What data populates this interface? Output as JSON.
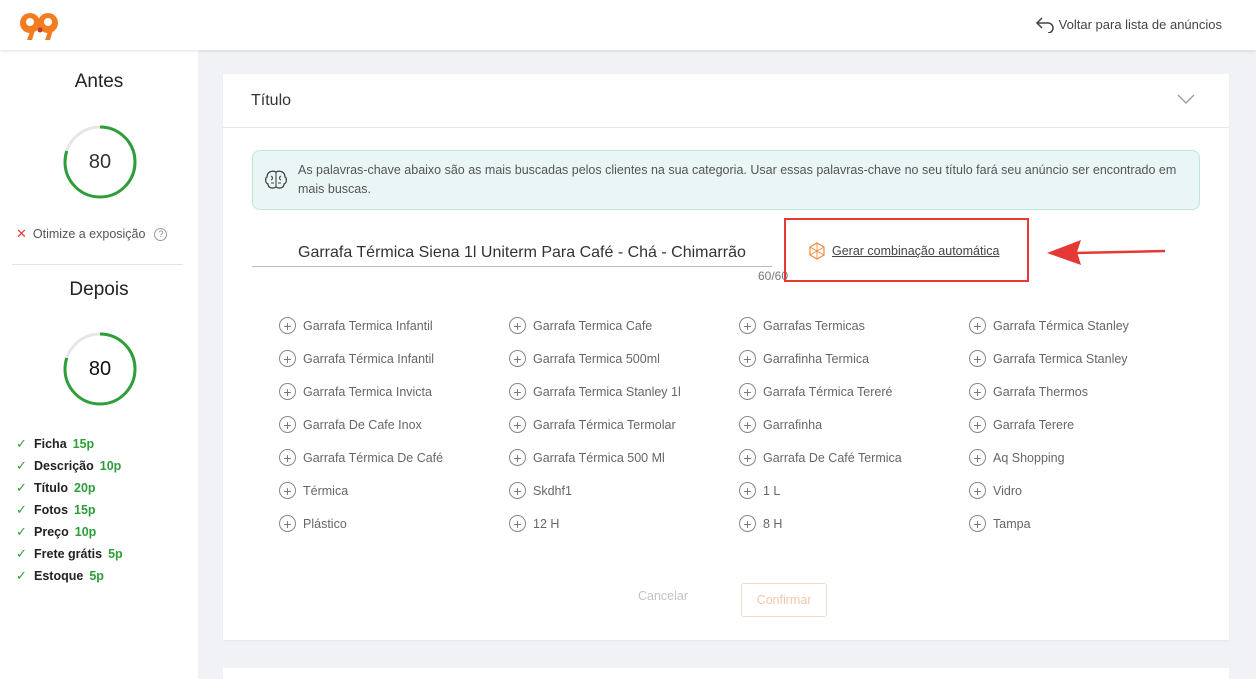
{
  "header": {
    "back_label": "Voltar para lista de anúncios"
  },
  "sidebar": {
    "before": {
      "title": "Antes",
      "score": "80",
      "score_fraction": 0.8
    },
    "warning": {
      "label": "Otimize a exposição"
    },
    "after": {
      "title": "Depois",
      "score": "80",
      "score_fraction": 0.8
    },
    "checklist": [
      {
        "label": "Ficha",
        "points": "15p"
      },
      {
        "label": "Descrição",
        "points": "10p"
      },
      {
        "label": "Título",
        "points": "20p"
      },
      {
        "label": "Fotos",
        "points": "15p"
      },
      {
        "label": "Preço",
        "points": "10p"
      },
      {
        "label": "Frete grátis",
        "points": "5p"
      },
      {
        "label": "Estoque",
        "points": "5p"
      }
    ]
  },
  "main": {
    "section_title": "Título",
    "info_text": "As palavras-chave abaixo são as mais buscadas pelos clientes na sua categoria. Usar essas palavras-chave no seu título fará seu anúncio ser encontrado em mais buscas.",
    "title_value": "Garrafa Térmica Siena 1l Uniterm Para Café - Chá - Chimarrão",
    "char_counter": "60/60",
    "generate_label": "Gerar combinação automática",
    "keywords": [
      [
        "Garrafa Termica Infantil",
        "Garrafa Termica Cafe",
        "Garrafas Termicas",
        "Garrafa Térmica Stanley"
      ],
      [
        "Garrafa Térmica Infantil",
        "Garrafa Termica 500ml",
        "Garrafinha Termica",
        "Garrafa Termica Stanley"
      ],
      [
        "Garrafa Termica Invicta",
        "Garrafa Termica Stanley 1l",
        "Garrafa Térmica Tereré",
        "Garrafa Thermos"
      ],
      [
        "Garrafa De Cafe Inox",
        "Garrafa Térmica Termolar",
        "Garrafinha",
        "Garrafa Terere"
      ],
      [
        "Garrafa Térmica De Café",
        "Garrafa Térmica 500 Ml",
        "Garrafa De Café Termica",
        "Aq Shopping"
      ],
      [
        "Térmica",
        "Skdhf1",
        "1 L",
        "Vidro"
      ],
      [
        "Plástico",
        "12 H",
        "8 H",
        "Tampa"
      ]
    ],
    "cancel_label": "Cancelar",
    "confirm_label": "Confirmar"
  },
  "colors": {
    "brand": "#f47c20",
    "gauge": "#2e9e3a",
    "highlight": "#e53935",
    "info_bg": "#e9f6f5"
  }
}
